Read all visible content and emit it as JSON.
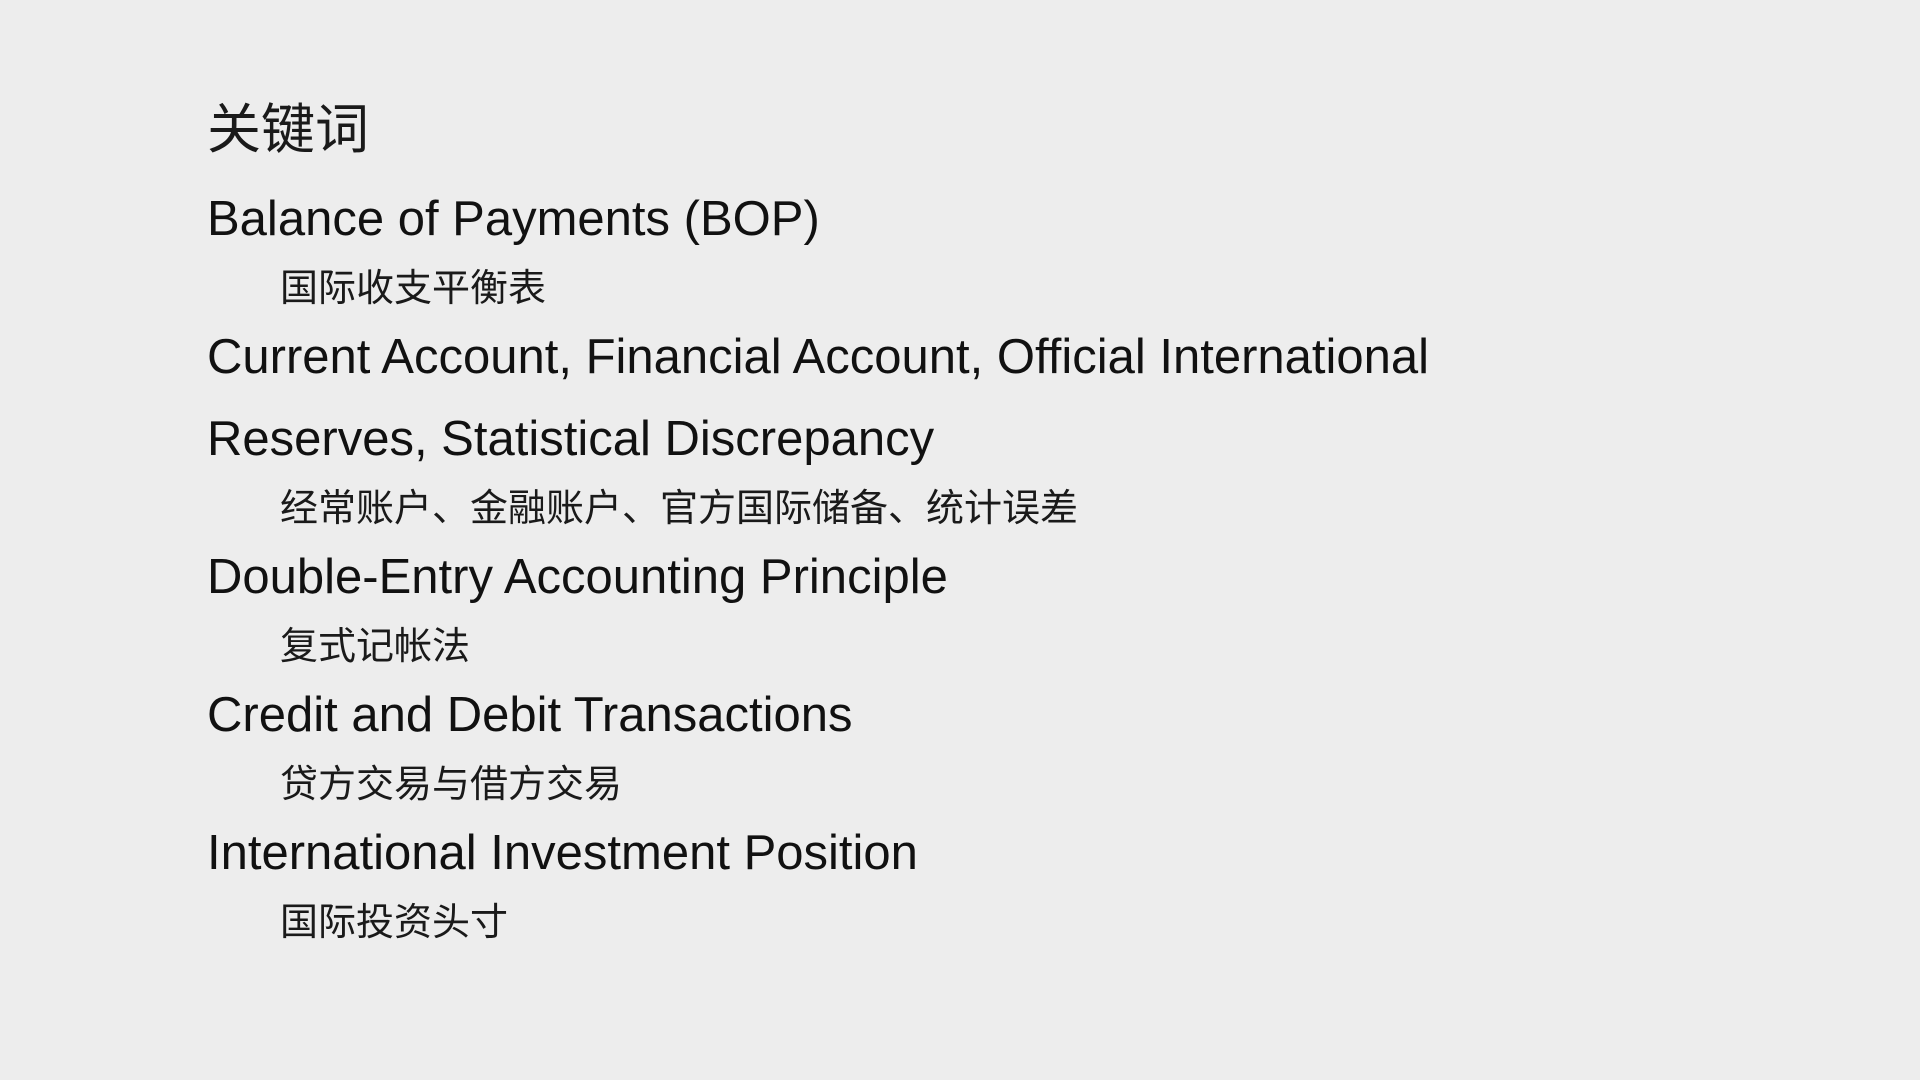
{
  "slide": {
    "title": "关键词",
    "terms": [
      {
        "english_lines": [
          "Balance of Payments (BOP)"
        ],
        "chinese": "国际收支平衡表"
      },
      {
        "english_lines": [
          "Current Account, Financial Account, Official International",
          "Reserves, Statistical Discrepancy"
        ],
        "chinese": "经常账户、金融账户、官方国际储备、统计误差"
      },
      {
        "english_lines": [
          "Double-Entry Accounting Principle"
        ],
        "chinese": "复式记帐法"
      },
      {
        "english_lines": [
          "Credit and Debit Transactions"
        ],
        "chinese": "贷方交易与借方交易"
      },
      {
        "english_lines": [
          "International Investment Position"
        ],
        "chinese": "国际投资头寸"
      }
    ]
  }
}
